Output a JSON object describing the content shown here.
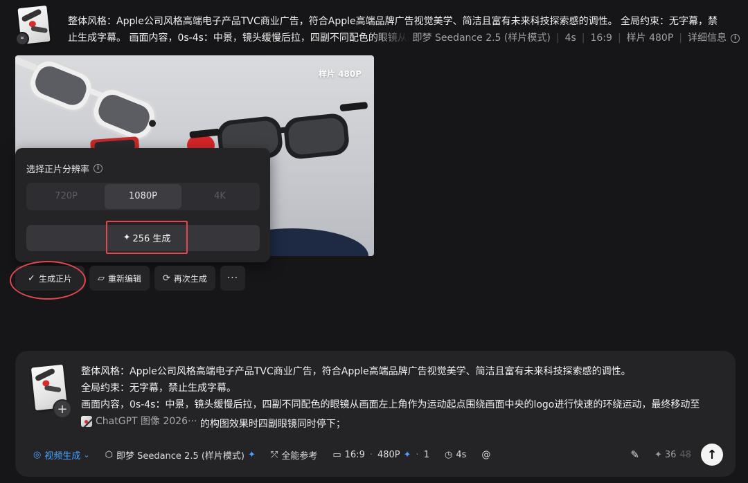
{
  "top_message": {
    "line1": "整体风格：Apple公司风格高端电子产品TVC商业广告，符合Apple高端品牌广告视觉美学、简洁且富有未来科技探索感的调性。 全局约束：无字幕，禁",
    "line2": "止生成字幕。 画面内容，0s-4s：中景，镜头缓慢后拉，四副不同配色的眼镜从画面左上角作为运动起点围绕画面中央的logo进行快速的环绕运动",
    "model": "即梦 Seedance 2.5 (样片模式)",
    "duration": "4s",
    "ratio": "16:9",
    "quality": "样片 480P",
    "details": "详细信息"
  },
  "preview": {
    "badge": "样片 480P"
  },
  "resolution_popup": {
    "title": "选择正片分辨率",
    "options": [
      "720P",
      "1080P",
      "4K"
    ],
    "selected": "1080P",
    "generate_label": "256 生成"
  },
  "actions": {
    "generate_final": "生成正片",
    "re_edit": "重新编辑",
    "regenerate": "再次生成",
    "more": "···"
  },
  "composer": {
    "line1": "整体风格：Apple公司风格高端电子产品TVC商业广告，符合Apple高端品牌广告视觉美学、简洁且富有未来科技探索感的调性。",
    "line2": "全局约束：无字幕，禁止生成字幕。",
    "line3": "画面内容，0s-4s：中景，镜头缓慢后拉，四副不同配色的眼镜从画面左上角作为运动起点围绕画面中央的logo进行快速的环绕运动，最终移动至",
    "chip_label": "ChatGPT 图像 2026···",
    "line4_rest": " 的构图效果时四副眼镜同时停下；",
    "toolbar": {
      "mode": "视频生成",
      "model": "即梦 Seedance 2.5 (样片模式)",
      "reference": "全能参考",
      "ratio": "16:9",
      "quality": "480P",
      "count": "1",
      "duration": "4s",
      "mention": "@",
      "credits_now": "36",
      "credits_old": "48"
    }
  },
  "colors": {
    "accent_red": "#e0484f",
    "accent_blue": "#4aa3ff",
    "background": "#161618",
    "panel": "#242427"
  }
}
